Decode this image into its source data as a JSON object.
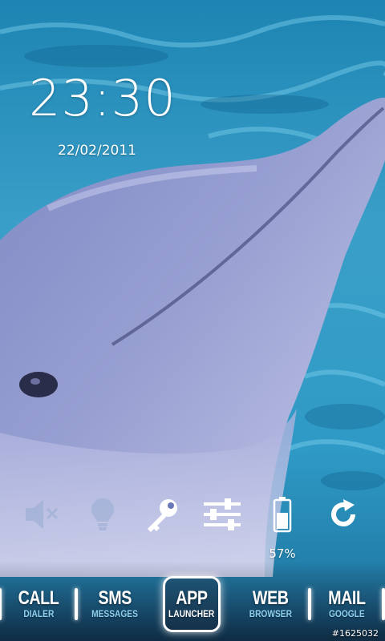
{
  "clock": {
    "time": "23:30",
    "date": "22/02/2011"
  },
  "toggles": [
    {
      "name": "volume-mute-icon",
      "state": "off"
    },
    {
      "name": "flashlight-icon",
      "state": "off"
    },
    {
      "name": "key-icon",
      "state": "on"
    },
    {
      "name": "settings-sliders-icon",
      "state": "on"
    },
    {
      "name": "battery-icon",
      "state": "on"
    },
    {
      "name": "refresh-icon",
      "state": "on"
    }
  ],
  "battery": {
    "percent_label": "57%",
    "level": 0.57
  },
  "dock": {
    "items": [
      {
        "main": "CALL",
        "sub": "DIALER"
      },
      {
        "main": "SMS",
        "sub": "MESSAGES"
      },
      {
        "main": "APP",
        "sub": "LAUNCHER"
      },
      {
        "main": "WEB",
        "sub": "BROWSER"
      },
      {
        "main": "MAIL",
        "sub": "GOOGLE"
      }
    ]
  },
  "footer": {
    "id": "#1625032"
  },
  "colors": {
    "water": "#2a8fb8",
    "dolphin": "#8a93c8",
    "accent_sub": "#8ed0f0"
  }
}
